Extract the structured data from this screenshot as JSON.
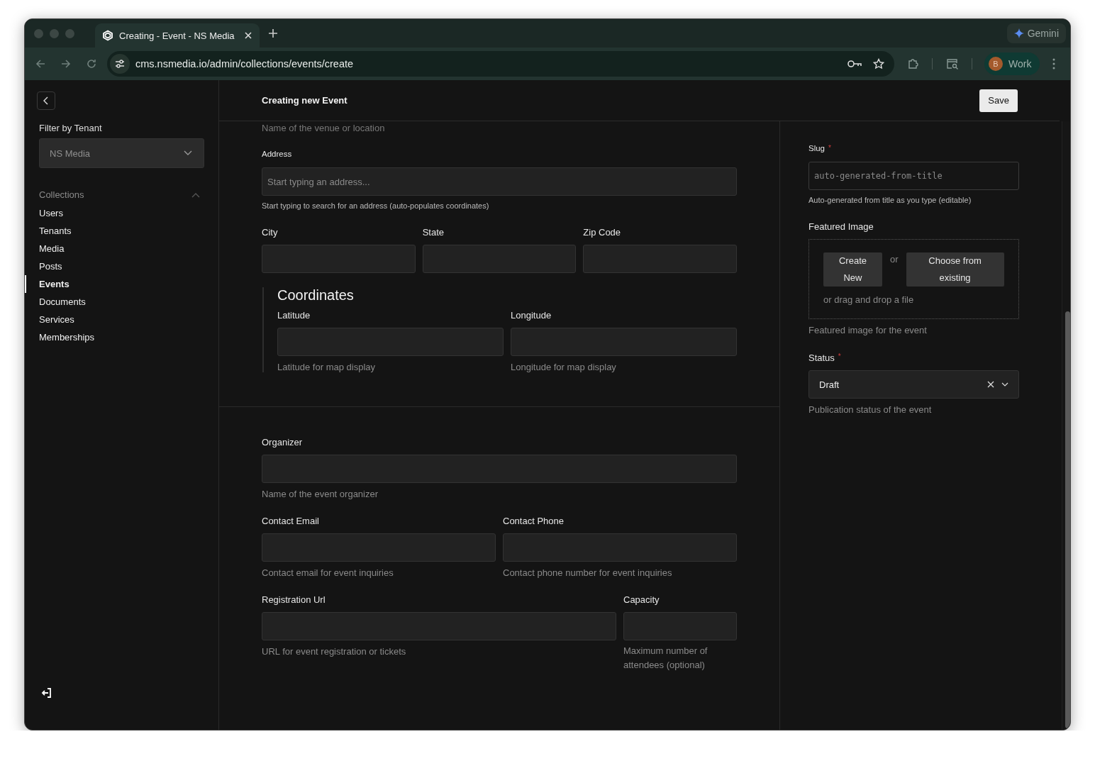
{
  "browser": {
    "tab_title": "Creating - Event - NS Media",
    "url": "cms.nsmedia.io/admin/collections/events/create",
    "gemini": "Gemini",
    "profile": {
      "initial": "B",
      "label": "Work"
    }
  },
  "sidebar": {
    "filter_label": "Filter by Tenant",
    "tenant": "NS Media",
    "collections_heading": "Collections",
    "expanded": true,
    "items": [
      {
        "label": "Users",
        "selected": false
      },
      {
        "label": "Tenants",
        "selected": false
      },
      {
        "label": "Media",
        "selected": false
      },
      {
        "label": "Posts",
        "selected": false
      },
      {
        "label": "Events",
        "selected": true
      },
      {
        "label": "Documents",
        "selected": false
      },
      {
        "label": "Services",
        "selected": false
      },
      {
        "label": "Memberships",
        "selected": false
      }
    ]
  },
  "header": {
    "title": "Creating new Event",
    "save": "Save"
  },
  "main": {
    "cut_hint": "Name of the venue or location",
    "address": {
      "label": "Address",
      "placeholder": "Start typing an address...",
      "hint": "Start typing to search for an address (auto-populates coordinates)"
    },
    "location_fields": [
      {
        "label": "City"
      },
      {
        "label": "State"
      },
      {
        "label": "Zip Code"
      }
    ],
    "coordinates": {
      "heading": "Coordinates",
      "fields": [
        {
          "label": "Latitude",
          "hint": "Latitude for map display"
        },
        {
          "label": "Longitude",
          "hint": "Longitude for map display"
        }
      ]
    },
    "organizer": {
      "label": "Organizer",
      "hint": "Name of the event organizer"
    },
    "contact_fields": [
      {
        "label": "Contact Email",
        "hint": "Contact email for event inquiries"
      },
      {
        "label": "Contact Phone",
        "hint": "Contact phone number for event inquiries"
      }
    ],
    "registration": {
      "label": "Registration Url",
      "hint": "URL for event registration or tickets"
    },
    "capacity": {
      "label": "Capacity",
      "hint": "Maximum number of attendees (optional)"
    }
  },
  "side": {
    "slug": {
      "label": "Slug",
      "required_mark": "*",
      "placeholder": "auto-generated-from-title",
      "hint": "Auto-generated from title as you type (editable)"
    },
    "featured_image": {
      "label": "Featured Image",
      "create": "Create New",
      "or": "or",
      "choose": "Choose from existing",
      "drop": "or drag and drop a file",
      "hint": "Featured image for the event"
    },
    "status": {
      "label": "Status",
      "required_mark": "*",
      "value": "Draft",
      "hint": "Publication status of the event"
    }
  }
}
